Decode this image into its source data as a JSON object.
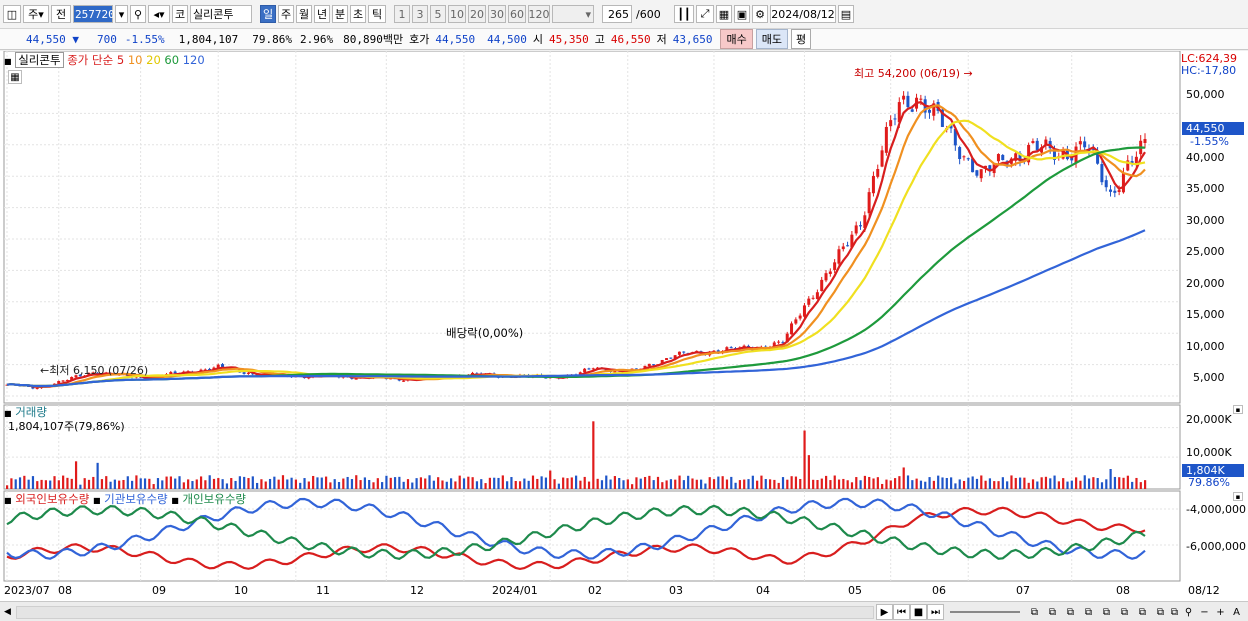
{
  "toolbar": {
    "stock_code": "257720",
    "market": "코",
    "stock_name": "실리콘투",
    "period_main": "주",
    "prev_label": "전",
    "periods": [
      "일",
      "주",
      "월",
      "년",
      "분",
      "초",
      "틱"
    ],
    "active_period": "일",
    "intervals": [
      "1",
      "3",
      "5",
      "10",
      "20",
      "30",
      "60",
      "120"
    ],
    "count": "265",
    "total": "/600",
    "date": "2024/08/12"
  },
  "infobar": {
    "price": "44,550",
    "change": "700",
    "change_pct": "-1.55%",
    "volume": "1,804,107",
    "turnover_pct": "79.86%",
    "pct2": "2.96%",
    "amount": "80,890백만",
    "bid_label": "호가",
    "bid1": "44,550",
    "bid2": "44,500",
    "open_label": "시",
    "open": "45,350",
    "high_label": "고",
    "high": "46,550",
    "low_label": "저",
    "low": "43,650",
    "buy_label": "매수",
    "sell_label": "매도",
    "eq_label": "평"
  },
  "legend": {
    "name": "실리콘투",
    "ma_label": "종가 단순",
    "ma_periods": [
      "5",
      "10",
      "20",
      "60",
      "120"
    ],
    "ma_colors": [
      "#d81e1e",
      "#f09020",
      "#f0e020",
      "#1e9a3c",
      "#3264d8"
    ]
  },
  "annotations": {
    "high": "최고 54,200 (06/19)",
    "low": "최저 6,150 (07/26)",
    "dividend": "배당락(0,00%)"
  },
  "price_axis": {
    "lc": "LC:624,39",
    "hc": "HC:-17,80",
    "ticks": [
      "50,000",
      "45,000",
      "40,000",
      "35,000",
      "30,000",
      "25,000",
      "20,000",
      "15,000",
      "10,000",
      "5,000"
    ],
    "current": "44,550",
    "current_pct": "-1.55%"
  },
  "volume_panel": {
    "title": "거래량",
    "value": "1,804,107주(79,86%)",
    "ticks": [
      "20,000K",
      "10,000K"
    ],
    "current": "1,804K",
    "current_pct": "79.86%"
  },
  "holding_panel": {
    "series": [
      "외국인보유수량",
      "기관보유수량",
      "개인보유수량"
    ],
    "colors": [
      "#d81e1e",
      "#3264d8",
      "#1e8a4c"
    ],
    "ticks": [
      "-4,000,000",
      "-6,000,000"
    ]
  },
  "x_axis": {
    "labels": [
      "2023/07",
      "08",
      "09",
      "10",
      "11",
      "12",
      "2024/01",
      "02",
      "03",
      "04",
      "05",
      "06",
      "07",
      "08"
    ],
    "end": "08/12"
  },
  "chart_data": {
    "type": "candlestick",
    "title": "실리콘투",
    "x_range": [
      "2023/07",
      "2024/08/12"
    ],
    "ylim": [
      3000,
      55000
    ],
    "highest": {
      "value": 54200,
      "date": "06/19"
    },
    "lowest": {
      "value": 6150,
      "date": "07/26"
    },
    "last": {
      "close": 44550,
      "open": 45350,
      "high": 46550,
      "low": 43650,
      "volume": 1804107
    },
    "month_closes": [
      {
        "month": "2023/07",
        "close": 7000
      },
      {
        "month": "08",
        "close": 8500
      },
      {
        "month": "09",
        "close": 8000
      },
      {
        "month": "10",
        "close": 9500
      },
      {
        "month": "11",
        "close": 8500
      },
      {
        "month": "12",
        "close": 8000
      },
      {
        "month": "2024/01",
        "close": 8500
      },
      {
        "month": "02",
        "close": 8300
      },
      {
        "month": "03",
        "close": 9000
      },
      {
        "month": "04",
        "close": 12500
      },
      {
        "month": "05",
        "close": 15000
      },
      {
        "month": "06",
        "close": 50000
      },
      {
        "month": "07",
        "close": 43000
      },
      {
        "month": "08",
        "close": 44550
      }
    ],
    "moving_averages": [
      {
        "name": "5",
        "last": 43500
      },
      {
        "name": "10",
        "last": 43200
      },
      {
        "name": "20",
        "last": 43800
      },
      {
        "name": "60",
        "last": 43500
      },
      {
        "name": "120",
        "last": 28000
      }
    ]
  },
  "bottom": {
    "buttons": [
      "▶",
      "⏮",
      "■",
      "⏭"
    ]
  }
}
